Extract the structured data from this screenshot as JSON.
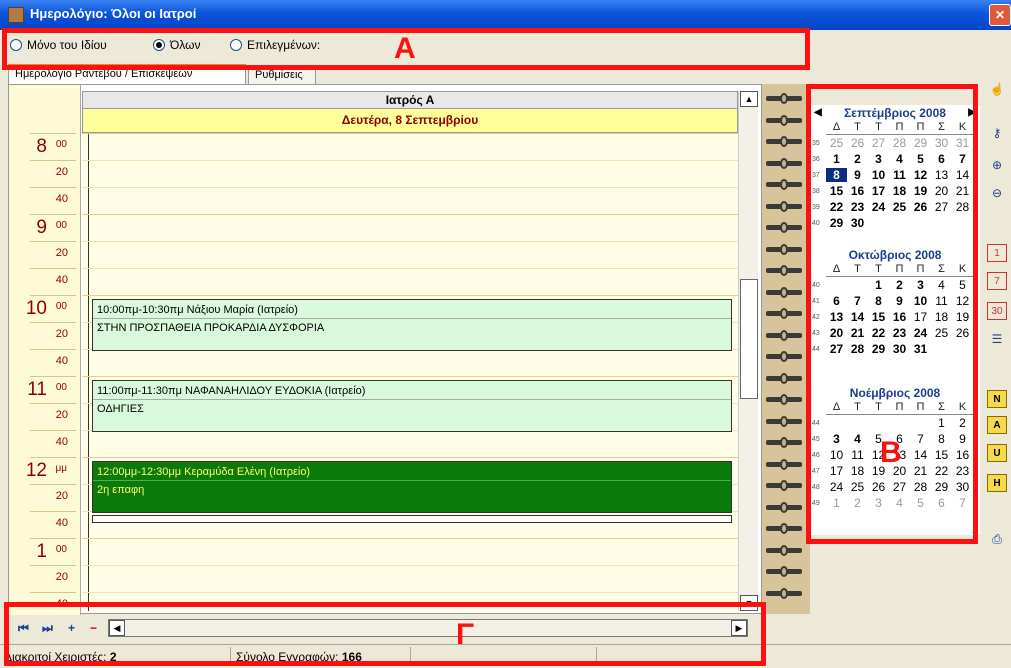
{
  "window": {
    "title": "Ημερολόγιο: Όλοι οι Ιατροί",
    "close_label": "✕"
  },
  "filter": {
    "options": [
      {
        "label": "Μόνο του Ιδίου",
        "selected": false
      },
      {
        "label": "Όλων",
        "selected": true
      },
      {
        "label": "Επιλεγμένων:",
        "selected": false
      }
    ]
  },
  "tabs": [
    "Ημερολόγιο Ραντεβού / Επισκέψεων",
    "Ρυθμίσεις"
  ],
  "day": {
    "doctor": "Ιατρός Α",
    "date": "Δευτέρα, 8 Σεπτεμβρίου"
  },
  "time_slots": [
    {
      "hour": "8",
      "suffix": "00"
    },
    {
      "hour": "9",
      "suffix": "00"
    },
    {
      "hour": "10",
      "suffix": "00"
    },
    {
      "hour": "11",
      "suffix": "00"
    },
    {
      "hour": "12",
      "suffix": "μμ"
    },
    {
      "hour": "1",
      "suffix": "00"
    }
  ],
  "minute_labels": [
    "20",
    "40"
  ],
  "appointments": [
    {
      "title": "10:00πμ-10:30πμ Νάξιου Μαρία (Ιατρείο)",
      "note": "ΣΤΗΝ ΠΡΟΣΠΑΘΕΙΑ ΠΡΟΚΑΡΔΙΑ ΔΥΣΦΟΡΙΑ",
      "style": "light"
    },
    {
      "title": "11:00πμ-11:30πμ ΝΑΦΑΝΑΗΛΙΔΟΥ ΕΥΔΟΚΙΑ (Ιατρείο)",
      "note": "ΟΔΗΓΙΕΣ",
      "style": "light"
    },
    {
      "title": "12:00μμ-12:30μμ Κεραμύδα Ελένη (Ιατρείο)",
      "note": "2η επαφη",
      "style": "dark"
    }
  ],
  "mini_calendars": {
    "weekday_headers": [
      "Δ",
      "Τ",
      "Τ",
      "Π",
      "Π",
      "Σ",
      "Κ"
    ],
    "months": [
      {
        "title": "Σεπτέμβριος 2008",
        "weeks": [
          {
            "wk": "35",
            "days": [
              [
                "25",
                "g"
              ],
              [
                "26",
                "g"
              ],
              [
                "27",
                "g"
              ],
              [
                "28",
                "g"
              ],
              [
                "29",
                "g"
              ],
              [
                "30",
                "g"
              ],
              [
                "31",
                "g"
              ]
            ]
          },
          {
            "wk": "36",
            "days": [
              [
                "1",
                "b"
              ],
              [
                "2",
                "b"
              ],
              [
                "3",
                "b"
              ],
              [
                "4",
                "b"
              ],
              [
                "5",
                "b"
              ],
              [
                "6",
                "b"
              ],
              [
                "7",
                "b"
              ]
            ]
          },
          {
            "wk": "37",
            "days": [
              [
                "8",
                "s"
              ],
              [
                "9",
                "b"
              ],
              [
                "10",
                "b"
              ],
              [
                "11",
                "b"
              ],
              [
                "12",
                "b"
              ],
              [
                "13",
                "n"
              ],
              [
                "14",
                "n"
              ]
            ]
          },
          {
            "wk": "38",
            "days": [
              [
                "15",
                "b"
              ],
              [
                "16",
                "b"
              ],
              [
                "17",
                "b"
              ],
              [
                "18",
                "b"
              ],
              [
                "19",
                "b"
              ],
              [
                "20",
                "n"
              ],
              [
                "21",
                "n"
              ]
            ]
          },
          {
            "wk": "39",
            "days": [
              [
                "22",
                "b"
              ],
              [
                "23",
                "b"
              ],
              [
                "24",
                "b"
              ],
              [
                "25",
                "b"
              ],
              [
                "26",
                "b"
              ],
              [
                "27",
                "n"
              ],
              [
                "28",
                "n"
              ]
            ]
          },
          {
            "wk": "40",
            "days": [
              [
                "29",
                "b"
              ],
              [
                "30",
                "b"
              ],
              [
                "",
                ""
              ],
              [
                "",
                ""
              ],
              [
                "",
                ""
              ],
              [
                "",
                ""
              ],
              [
                "",
                ""
              ]
            ]
          }
        ]
      },
      {
        "title": "Οκτώβριος 2008",
        "weeks": [
          {
            "wk": "40",
            "days": [
              [
                "",
                ""
              ],
              [
                "",
                ""
              ],
              [
                "1",
                "b"
              ],
              [
                "2",
                "b"
              ],
              [
                "3",
                "b"
              ],
              [
                "4",
                "n"
              ],
              [
                "5",
                "n"
              ]
            ]
          },
          {
            "wk": "41",
            "days": [
              [
                "6",
                "b"
              ],
              [
                "7",
                "b"
              ],
              [
                "8",
                "b"
              ],
              [
                "9",
                "b"
              ],
              [
                "10",
                "b"
              ],
              [
                "11",
                "n"
              ],
              [
                "12",
                "n"
              ]
            ]
          },
          {
            "wk": "42",
            "days": [
              [
                "13",
                "b"
              ],
              [
                "14",
                "b"
              ],
              [
                "15",
                "b"
              ],
              [
                "16",
                "b"
              ],
              [
                "17",
                "n"
              ],
              [
                "18",
                "n"
              ],
              [
                "19",
                "n"
              ]
            ]
          },
          {
            "wk": "43",
            "days": [
              [
                "20",
                "b"
              ],
              [
                "21",
                "b"
              ],
              [
                "22",
                "b"
              ],
              [
                "23",
                "b"
              ],
              [
                "24",
                "b"
              ],
              [
                "25",
                "n"
              ],
              [
                "26",
                "n"
              ]
            ]
          },
          {
            "wk": "44",
            "days": [
              [
                "27",
                "b"
              ],
              [
                "28",
                "b"
              ],
              [
                "29",
                "b"
              ],
              [
                "30",
                "b"
              ],
              [
                "31",
                "b"
              ],
              [
                "",
                ""
              ],
              [
                "",
                ""
              ]
            ]
          }
        ]
      },
      {
        "title": "Νοέμβριος 2008",
        "weeks": [
          {
            "wk": "44",
            "days": [
              [
                "",
                ""
              ],
              [
                "",
                ""
              ],
              [
                "",
                ""
              ],
              [
                "",
                ""
              ],
              [
                "",
                ""
              ],
              [
                "1",
                "n"
              ],
              [
                "2",
                "n"
              ]
            ]
          },
          {
            "wk": "45",
            "days": [
              [
                "3",
                "b"
              ],
              [
                "4",
                "b"
              ],
              [
                "5",
                "n"
              ],
              [
                "6",
                "n"
              ],
              [
                "7",
                "n"
              ],
              [
                "8",
                "n"
              ],
              [
                "9",
                "n"
              ]
            ]
          },
          {
            "wk": "46",
            "days": [
              [
                "10",
                "n"
              ],
              [
                "11",
                "n"
              ],
              [
                "12",
                "n"
              ],
              [
                "13",
                "n"
              ],
              [
                "14",
                "n"
              ],
              [
                "15",
                "n"
              ],
              [
                "16",
                "n"
              ]
            ]
          },
          {
            "wk": "47",
            "days": [
              [
                "17",
                "n"
              ],
              [
                "18",
                "n"
              ],
              [
                "19",
                "n"
              ],
              [
                "20",
                "n"
              ],
              [
                "21",
                "n"
              ],
              [
                "22",
                "n"
              ],
              [
                "23",
                "n"
              ]
            ]
          },
          {
            "wk": "48",
            "days": [
              [
                "24",
                "n"
              ],
              [
                "25",
                "n"
              ],
              [
                "26",
                "n"
              ],
              [
                "27",
                "n"
              ],
              [
                "28",
                "n"
              ],
              [
                "29",
                "n"
              ],
              [
                "30",
                "n"
              ]
            ]
          },
          {
            "wk": "49",
            "days": [
              [
                "1",
                "g"
              ],
              [
                "2",
                "g"
              ],
              [
                "3",
                "g"
              ],
              [
                "4",
                "g"
              ],
              [
                "5",
                "g"
              ],
              [
                "6",
                "g"
              ],
              [
                "7",
                "g"
              ]
            ]
          }
        ]
      }
    ]
  },
  "side_toolbar": [
    {
      "icon": "hand-icon",
      "glyph": "☝"
    },
    {
      "icon": "key-icon",
      "glyph": "⚷"
    },
    {
      "icon": "zoom-in-icon",
      "glyph": "⊕"
    },
    {
      "icon": "zoom-out-icon",
      "glyph": "⊖"
    },
    {
      "icon": "day-view-icon",
      "glyph": "1"
    },
    {
      "icon": "week-view-icon",
      "glyph": "7"
    },
    {
      "icon": "month-view-icon",
      "glyph": "30"
    },
    {
      "icon": "list-view-icon",
      "glyph": "☰"
    },
    {
      "icon": "n-icon",
      "glyph": "N"
    },
    {
      "icon": "a-icon",
      "glyph": "A"
    },
    {
      "icon": "u-icon",
      "glyph": "U"
    },
    {
      "icon": "h-icon",
      "glyph": "H"
    },
    {
      "icon": "print-icon",
      "glyph": "⎙"
    }
  ],
  "bottom_nav": {
    "first": "⏮",
    "last": "⏭",
    "add": "+",
    "remove": "−",
    "left": "◀",
    "right": "▶"
  },
  "status": {
    "users_label": "Διακριτοί Χειριστές:",
    "users_value": "2",
    "records_label": "Σύνολο Εγγραφών:",
    "records_value": "166"
  },
  "annotations": {
    "a": "A",
    "b": "B",
    "c": "Γ",
    "color": "#ff1010"
  }
}
